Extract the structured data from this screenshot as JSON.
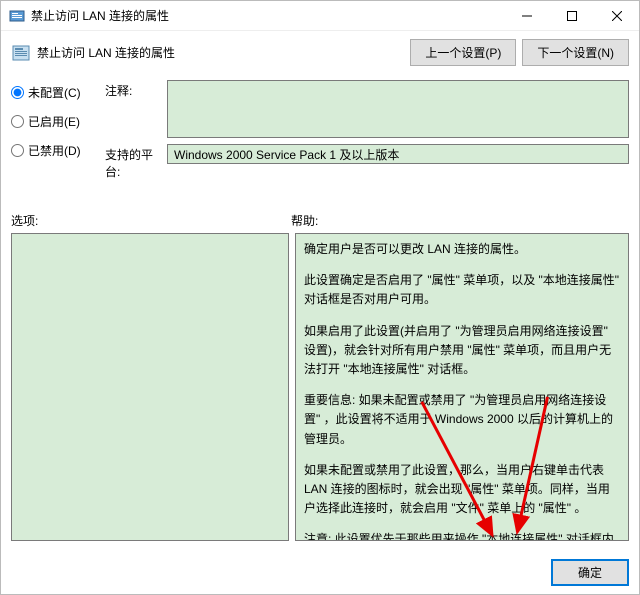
{
  "window": {
    "title": "禁止访问 LAN 连接的属性"
  },
  "header": {
    "title": "禁止访问 LAN 连接的属性",
    "prev_btn": "上一个设置(P)",
    "next_btn": "下一个设置(N)"
  },
  "radios": {
    "not_configured": "未配置(C)",
    "enabled": "已启用(E)",
    "disabled": "已禁用(D)"
  },
  "fields": {
    "comment_label": "注释:",
    "comment_value": "",
    "platform_label": "支持的平台:",
    "platform_value": "Windows 2000 Service Pack 1 及以上版本"
  },
  "labels": {
    "options": "选项:",
    "help": "帮助:"
  },
  "help_paragraphs": [
    "确定用户是否可以更改 LAN 连接的属性。",
    "此设置确定是否启用了 \"属性\" 菜单项，以及 \"本地连接属性\" 对话框是否对用户可用。",
    "如果启用了此设置(并启用了 \"为管理员启用网络连接设置\" 设置)，就会针对所有用户禁用 \"属性\" 菜单项，而且用户无法打开 \"本地连接属性\" 对话框。",
    "重要信息: 如果未配置或禁用了 \"为管理员启用网络连接设置\" ，此设置将不适用于 Windows 2000 以后的计算机上的管理员。",
    "如果未配置或禁用了此设置，那么，当用户右键单击代表 LAN 连接的图标时，就会出现 \"属性\" 菜单项。同样，当用户选择此连接时，就会启用 \"文件\" 菜单上的 \"属性\" 。",
    "注意: 此设置优先于那些用来操作 \"本地连接属性\" 对话框内功能可用性的设置。如果启用了此设置，用户将无法使用 LAN 连接属性对话框内的任何功能。"
  ],
  "footer": {
    "ok": "确定",
    "cancel": "",
    "apply": ""
  }
}
